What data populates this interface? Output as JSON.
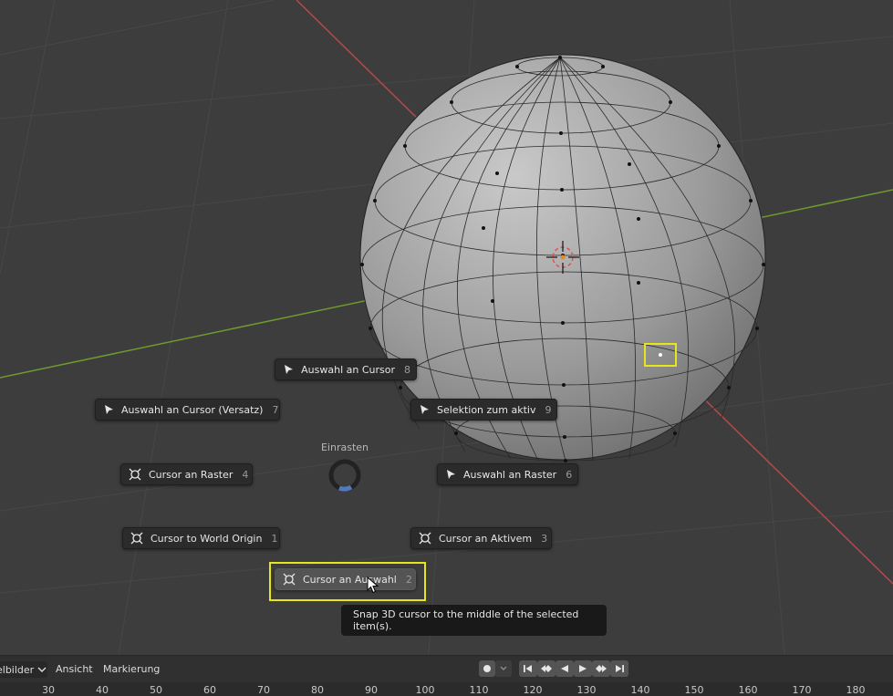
{
  "pie_menu": {
    "title": "Einrasten",
    "items": [
      {
        "label": "Auswahl an Cursor",
        "key": "8",
        "icon": "select-cursor-icon"
      },
      {
        "label": "Auswahl an Cursor (Versatz)",
        "key": "7",
        "icon": "select-cursor-icon"
      },
      {
        "label": "Selektion zum aktiv",
        "key": "9",
        "icon": "select-cursor-icon"
      },
      {
        "label": "Cursor an Raster",
        "key": "4",
        "icon": "3d-cursor-icon"
      },
      {
        "label": "Auswahl an Raster",
        "key": "6",
        "icon": "select-cursor-icon"
      },
      {
        "label": "Cursor to World Origin",
        "key": "1",
        "icon": "3d-cursor-icon"
      },
      {
        "label": "Cursor an Aktivem",
        "key": "3",
        "icon": "3d-cursor-icon"
      },
      {
        "label": "Cursor an Auswahl",
        "key": "2",
        "icon": "3d-cursor-icon"
      }
    ]
  },
  "tooltip": {
    "text": "Snap 3D cursor to the middle of the selected item(s)."
  },
  "timeline": {
    "editor_label": "elbilder",
    "menus": [
      "Ansicht",
      "Markierung"
    ],
    "ruler_ticks": [
      "30",
      "40",
      "50",
      "60",
      "70",
      "80",
      "90",
      "100",
      "110",
      "120",
      "130",
      "140",
      "150",
      "160",
      "170",
      "180"
    ]
  },
  "colors": {
    "highlight": "#e6e619",
    "x_axis": "#b34a4a",
    "y_axis": "#6e9a2e"
  }
}
